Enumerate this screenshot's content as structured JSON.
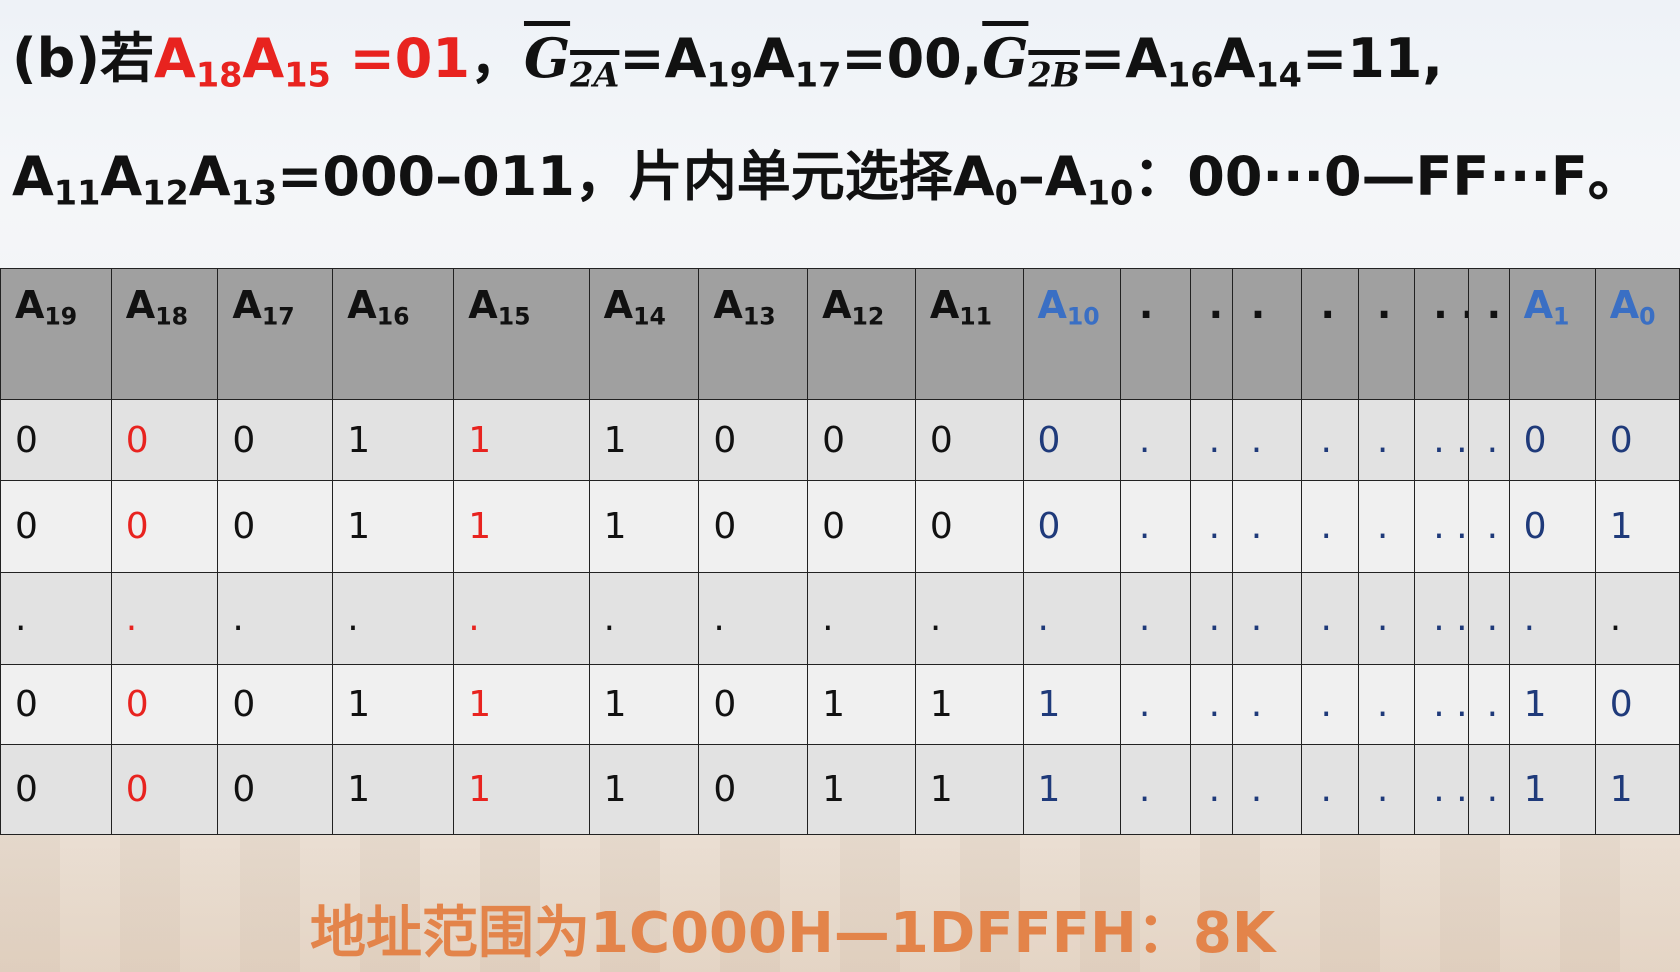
{
  "line1": {
    "prefix": "(b)若",
    "red_a18": "A",
    "red_a18_sub": "18",
    "red_a15": "A",
    "red_a15_sub": "15",
    "red_eq": " =01",
    "sep1": "，",
    "g2a_letter": "G",
    "g2a_sub": "2A",
    "g2a_eq_a": "=A",
    "g2a_eq_sub1": "19",
    "g2a_eq_b": "A",
    "g2a_eq_sub2": "17",
    "g2a_eq_val": "=00,",
    "g2b_letter": "G",
    "g2b_sub": "2B",
    "g2b_eq_a": "=A",
    "g2b_eq_sub1": "16",
    "g2b_eq_b": "A",
    "g2b_eq_sub2": "14",
    "g2b_eq_val": "=11,"
  },
  "line2": {
    "a": "A",
    "s1": "11",
    "b": "A",
    "s2": "12",
    "c": "A",
    "s3": "13",
    "mid": "=000–011，片内单元选择",
    "d": "A",
    "s4": "0",
    "dash": "–",
    "e": "A",
    "s5": "10",
    "tail": "：00···0—FF···F。"
  },
  "table": {
    "headers": [
      {
        "base": "A",
        "sub": "19"
      },
      {
        "base": "A",
        "sub": "18"
      },
      {
        "base": "A",
        "sub": "17"
      },
      {
        "base": "A",
        "sub": "16"
      },
      {
        "base": "A",
        "sub": "15"
      },
      {
        "base": "A",
        "sub": "14"
      },
      {
        "base": "A",
        "sub": "13"
      },
      {
        "base": "A",
        "sub": "12"
      },
      {
        "base": "A",
        "sub": "11"
      },
      {
        "base": "A",
        "sub": "10"
      },
      {
        "base": "."
      },
      {
        "base": ". ."
      },
      {
        "base": "."
      },
      {
        "base": "."
      },
      {
        "base": "."
      },
      {
        "base": ". ."
      },
      {
        "base": "."
      },
      {
        "base": "A",
        "sub": "1"
      },
      {
        "base": "A",
        "sub": "0"
      }
    ],
    "rows": [
      [
        "0",
        "0",
        "0",
        "1",
        "1",
        "1",
        "0",
        "0",
        "0",
        "0",
        ".",
        ". .",
        ".",
        ".",
        ".",
        ". .",
        ".",
        "0",
        "0"
      ],
      [
        "0",
        "0",
        "0",
        "1",
        "1",
        "1",
        "0",
        "0",
        "0",
        "0",
        ".",
        ". .",
        ".",
        ".",
        ".",
        ". .",
        ".",
        "0",
        "1"
      ],
      [
        ".",
        ".",
        ".",
        ".",
        ".",
        ".",
        ".",
        ".",
        ".",
        ".",
        ".",
        ". .",
        ".",
        ".",
        ".",
        ". .",
        ".",
        ".",
        "."
      ],
      [
        "0",
        "0",
        "0",
        "1",
        "1",
        "1",
        "0",
        "1",
        "1",
        "1",
        ".",
        ". .",
        ".",
        ".",
        ".",
        ". .",
        ".",
        "1",
        "0"
      ],
      [
        "0",
        "0",
        "0",
        "1",
        "1",
        "1",
        "0",
        "1",
        "1",
        "1",
        ".",
        ". .",
        ".",
        ".",
        ".",
        ". .",
        ".",
        "1",
        "1"
      ]
    ]
  },
  "result": "地址范围为1C000H—1DFFFH：8K",
  "colors": {
    "red": "#e8231f",
    "blue_header": "#3a6fc4",
    "blue_cell": "#1f3a7a",
    "orange": "#e3844a",
    "header_bg": "#a0a0a0"
  }
}
